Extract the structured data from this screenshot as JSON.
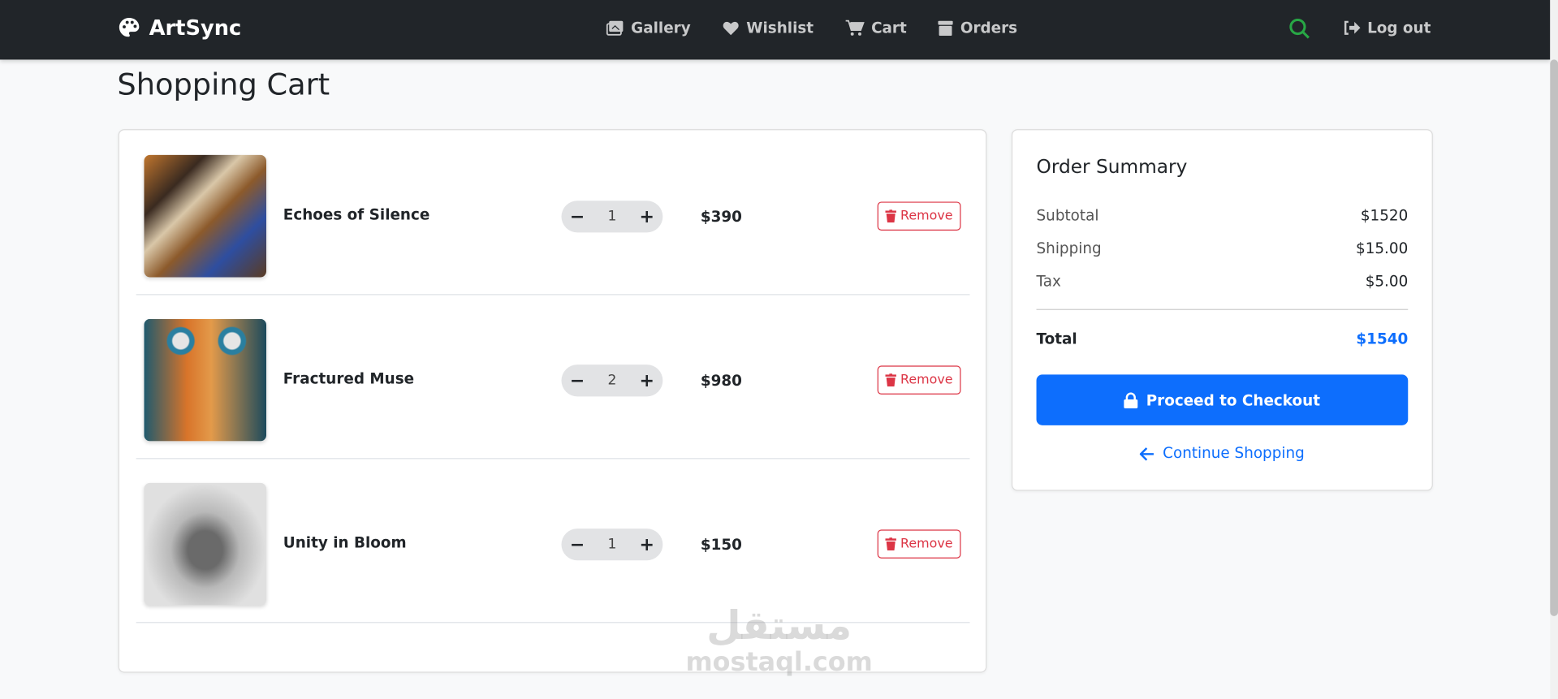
{
  "nav": {
    "brand": "ArtSync",
    "links": [
      {
        "label": "Gallery",
        "icon": "images-icon"
      },
      {
        "label": "Wishlist",
        "icon": "heart-icon"
      },
      {
        "label": "Cart",
        "icon": "cart-icon"
      },
      {
        "label": "Orders",
        "icon": "box-icon"
      }
    ],
    "logout": "Log out"
  },
  "page_title": "Shopping Cart",
  "items": [
    {
      "name": "Echoes of Silence",
      "qty": "1",
      "price": "$390",
      "remove": "Remove"
    },
    {
      "name": "Fractured Muse",
      "qty": "2",
      "price": "$980",
      "remove": "Remove"
    },
    {
      "name": "Unity in Bloom",
      "qty": "1",
      "price": "$150",
      "remove": "Remove"
    }
  ],
  "summary": {
    "title": "Order Summary",
    "subtotal_label": "Subtotal",
    "subtotal": "$1520",
    "shipping_label": "Shipping",
    "shipping": "$15.00",
    "tax_label": "Tax",
    "tax": "$5.00",
    "total_label": "Total",
    "total": "$1540",
    "checkout": "Proceed to Checkout",
    "continue": "Continue Shopping"
  },
  "watermark": {
    "arabic": "مستقل",
    "latin": "mostaql.com"
  },
  "colors": {
    "primary": "#0d6efd",
    "danger": "#dc3545",
    "navbar": "#212529",
    "search": "#28a745"
  }
}
